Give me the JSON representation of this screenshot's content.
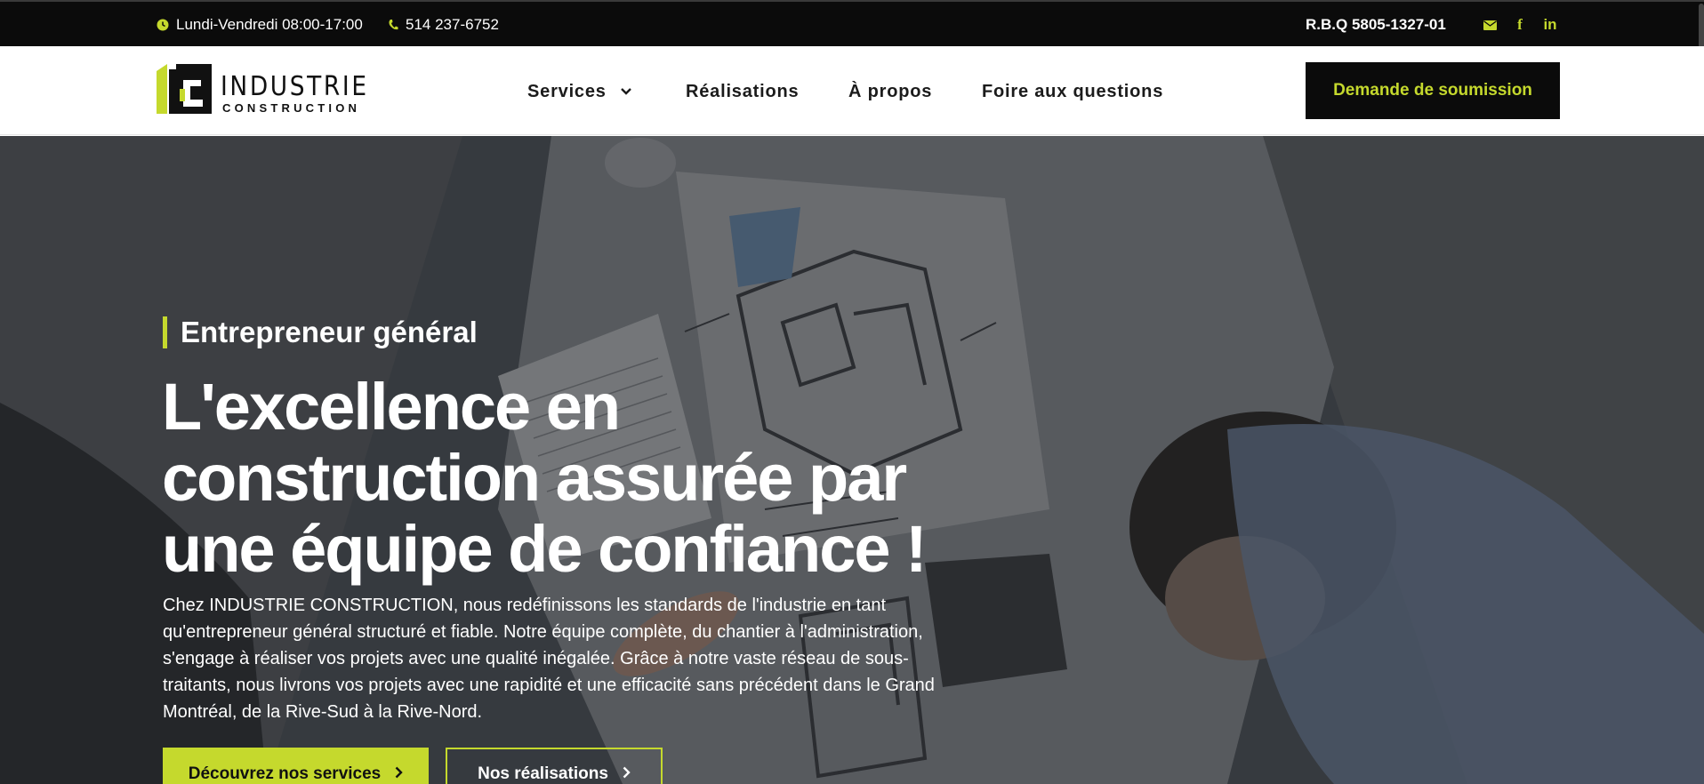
{
  "topbar": {
    "hours": "Lundi-Vendredi 08:00-17:00",
    "phone": "514 237-6752",
    "rbq": "R.B.Q 5805-1327-01",
    "icons": [
      "clock-icon",
      "phone-icon",
      "mail-icon",
      "facebook-icon",
      "linkedin-icon"
    ]
  },
  "logo": {
    "word1": "INDUSTRIE",
    "word2": "CONSTRUCTION"
  },
  "nav": {
    "services": "Services",
    "realisations": "Réalisations",
    "about": "À propos",
    "faq": "Foire aux questions"
  },
  "cta": "Demande de soumission",
  "hero": {
    "eyebrow": "Entrepreneur général",
    "title": "L'excellence en construction assurée par une équipe de confiance !",
    "text": "Chez INDUSTRIE CONSTRUCTION, nous redéfinissons les standards de l'industrie en tant qu'entrepreneur général structuré et fiable. Notre équipe complète, du chantier à l'administration, s'engage à réaliser vos projets avec une qualité inégalée. Grâce à notre vaste réseau de sous-traitants, nous livrons vos projets avec une rapidité et une efficacité sans précédent dans le Grand Montréal, de la Rive-Sud à la Rive-Nord.",
    "btn_primary": "Découvrez nos services",
    "btn_secondary": "Nos réalisations"
  },
  "colors": {
    "accent": "#c5d92d",
    "dark": "#0b0b0b"
  }
}
